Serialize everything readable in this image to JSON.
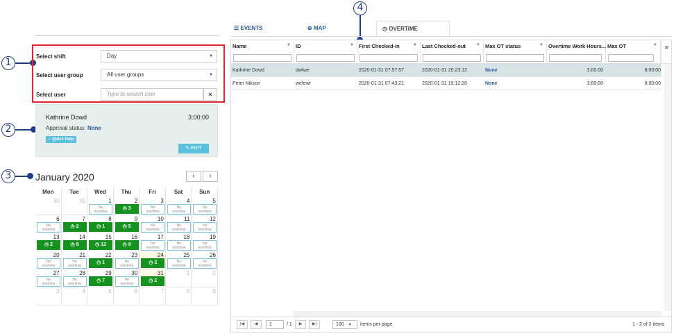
{
  "callouts": [
    "1",
    "2",
    "3",
    "4"
  ],
  "filters": {
    "shift_label": "Select shift",
    "shift_value": "Day",
    "group_label": "Select user group",
    "group_value": "All user groups",
    "user_label": "Select user",
    "user_placeholder": "Type to search user",
    "clear_glyph": "×"
  },
  "card": {
    "name": "Kathrine Dowd",
    "hours": "3:00:00",
    "approval_label": "Approval status:",
    "approval_value": "None",
    "help_label": "Quick Help",
    "edit_label": "EDIT"
  },
  "calendar": {
    "title": "January 2020",
    "prev": "‹",
    "next": "›",
    "no_ot_line1": "No",
    "no_ot_line2": "overtime",
    "weekdays": [
      "Mon",
      "Tue",
      "Wed",
      "Thu",
      "Fri",
      "Sat",
      "Sun"
    ],
    "weeks": [
      [
        {
          "d": "30",
          "m": true
        },
        {
          "d": "31",
          "m": true
        },
        {
          "d": "1",
          "k": "no"
        },
        {
          "d": "2",
          "k": "ot",
          "n": "3"
        },
        {
          "d": "3",
          "k": "no"
        },
        {
          "d": "4",
          "k": "no"
        },
        {
          "d": "5",
          "k": "no"
        }
      ],
      [
        {
          "d": "6",
          "k": "no"
        },
        {
          "d": "7",
          "k": "ot",
          "n": "2"
        },
        {
          "d": "8",
          "k": "ot",
          "n": "1"
        },
        {
          "d": "9",
          "k": "ot",
          "n": "5"
        },
        {
          "d": "10",
          "k": "no"
        },
        {
          "d": "11",
          "k": "no"
        },
        {
          "d": "12",
          "k": "no"
        }
      ],
      [
        {
          "d": "13",
          "k": "ot",
          "n": "2"
        },
        {
          "d": "14",
          "k": "ot",
          "n": "8"
        },
        {
          "d": "15",
          "k": "ot",
          "n": "12"
        },
        {
          "d": "16",
          "k": "ot",
          "n": "9"
        },
        {
          "d": "17",
          "k": "no"
        },
        {
          "d": "18",
          "k": "no"
        },
        {
          "d": "19",
          "k": "no"
        }
      ],
      [
        {
          "d": "20",
          "k": "no"
        },
        {
          "d": "21",
          "k": "no"
        },
        {
          "d": "22",
          "k": "ot",
          "n": "1"
        },
        {
          "d": "23",
          "k": "no"
        },
        {
          "d": "24",
          "k": "ot",
          "n": "2",
          "t": true
        },
        {
          "d": "25",
          "k": "no"
        },
        {
          "d": "26",
          "k": "no"
        }
      ],
      [
        {
          "d": "27",
          "k": "no"
        },
        {
          "d": "28",
          "k": "no"
        },
        {
          "d": "29",
          "k": "ot",
          "n": "7"
        },
        {
          "d": "30",
          "k": "no"
        },
        {
          "d": "31",
          "k": "ot",
          "n": "2",
          "t": true
        },
        {
          "d": "1",
          "m": true
        },
        {
          "d": "2",
          "m": true
        }
      ],
      [
        {
          "d": "3",
          "m": true
        },
        {
          "d": "4",
          "m": true
        },
        {
          "d": "5",
          "m": true
        },
        {
          "d": "6",
          "m": true
        },
        {
          "d": "7",
          "m": true
        },
        {
          "d": "8",
          "m": true
        },
        {
          "d": "9",
          "m": true
        }
      ]
    ]
  },
  "tabs": {
    "events": "EVENTS",
    "map": "MAP",
    "overtime": "OVERTIME"
  },
  "grid": {
    "columns": [
      "Name",
      "ID",
      "First Checked-in",
      "Last Checked-out",
      "Max OT status",
      "Overtime Work Hours...",
      "Max OT"
    ],
    "rows": [
      [
        "Kathrine Dowd",
        "dwfwe",
        "2020-01-31 07:57:57",
        "2020-01-31 20:23:12",
        "None",
        "3:00:00",
        "8:00:00"
      ],
      [
        "Peter Nikson",
        "wefewr",
        "2020-01-31 07:43:21",
        "2020-01-31 19:12:20",
        "None",
        "3:00:00",
        "8:00:00"
      ]
    ],
    "menu_glyph": "≡"
  },
  "pager": {
    "page": "1",
    "of": "/ 1",
    "page_size": "100",
    "items_per_page": "items per page",
    "summary": "1 - 2 of 2 items"
  }
}
